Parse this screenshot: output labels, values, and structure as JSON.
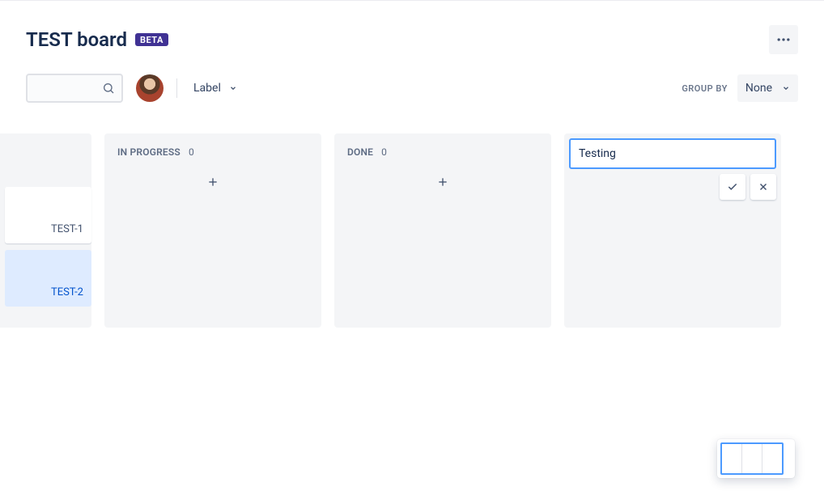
{
  "header": {
    "title": "TEST board",
    "badge": "BETA"
  },
  "toolbar": {
    "label_filter": "Label",
    "groupby_label": "GROUP BY",
    "groupby_value": "None"
  },
  "columns": {
    "partial": {
      "cards": [
        {
          "key": "TEST-1"
        },
        {
          "key": "TEST-2"
        }
      ]
    },
    "in_progress": {
      "name": "IN PROGRESS",
      "count": "0"
    },
    "done": {
      "name": "DONE",
      "count": "0"
    },
    "new_column_input": "Testing"
  }
}
